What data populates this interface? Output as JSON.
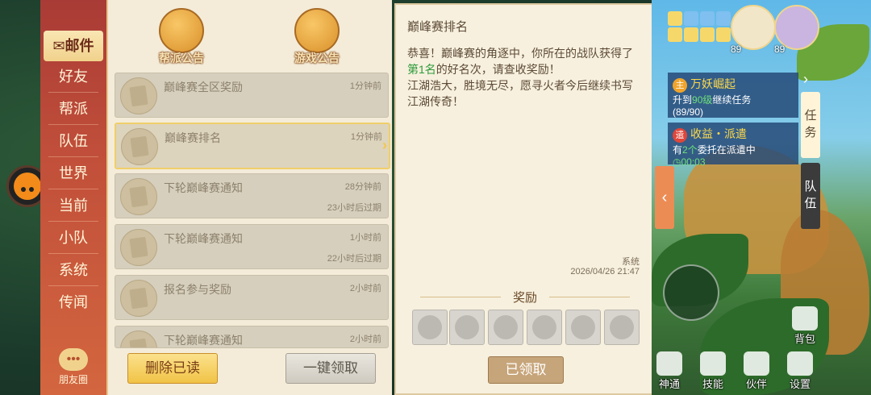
{
  "sidebar": {
    "tabs": [
      {
        "label": "邮件",
        "icon": "mail-icon"
      },
      {
        "label": "好友"
      },
      {
        "label": "帮派"
      },
      {
        "label": "队伍"
      },
      {
        "label": "世界"
      },
      {
        "label": "当前"
      },
      {
        "label": "小队"
      },
      {
        "label": "系统"
      },
      {
        "label": "传闻"
      }
    ],
    "friends_label": "朋友圈"
  },
  "announcements": {
    "guild": "帮派公告",
    "game": "游戏公告"
  },
  "mails": [
    {
      "title": "巅峰赛全区奖励",
      "time": "1分钟前",
      "expire": ""
    },
    {
      "title": "巅峰赛排名",
      "time": "1分钟前",
      "expire": ""
    },
    {
      "title": "下轮巅峰赛通知",
      "time": "28分钟前",
      "expire": "23小时后过期"
    },
    {
      "title": "下轮巅峰赛通知",
      "time": "1小时前",
      "expire": "22小时后过期"
    },
    {
      "title": "报名参与奖励",
      "time": "2小时前",
      "expire": ""
    },
    {
      "title": "下轮巅峰赛通知",
      "time": "2小时前",
      "expire": ""
    }
  ],
  "buttons": {
    "delete_read": "删除已读",
    "claim_all": "一键领取"
  },
  "detail": {
    "title": "巅峰赛排名",
    "body_1": "恭喜！巅峰赛的角逐中，你所在的战队获得了",
    "body_rank": "第1名",
    "body_2": "的好名次，请查收奖励！",
    "body_3": "江湖浩大，胜境无尽，愿寻火者今后继续书写江湖传奇！",
    "sender": "系统",
    "date": "2026/04/26 21:47",
    "reward_label": "奖励",
    "claimed_label": "已领取"
  },
  "hud": {
    "player_level": "89",
    "pet_level": "89",
    "quests": [
      {
        "badge": "主",
        "title": "万妖崛起",
        "line1_pre": "升到",
        "line1_hl": "90级",
        "line1_post": "继续任务",
        "line2": "(89/90)"
      },
      {
        "badge": "遣",
        "title": "收益・派遣",
        "line1_pre": "有",
        "line1_hl": "2个",
        "line1_post": "委托在派遣中",
        "line2": "00:03"
      }
    ],
    "side_tabs": [
      "任务",
      "队伍"
    ],
    "bottom_buttons": [
      "神通",
      "技能",
      "伙伴",
      "设置"
    ],
    "bag_label": "背包"
  },
  "colors": {
    "accent_gold": "#f1c346",
    "highlight_green": "#2f9b3c",
    "sidebar_red": "#a93b36"
  }
}
